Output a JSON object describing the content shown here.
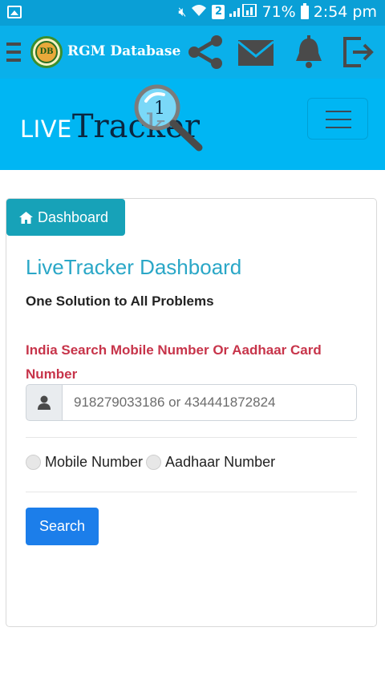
{
  "status_bar": {
    "battery_percent": "71%",
    "time": "2:54 pm",
    "sim_slot": "2",
    "icons": [
      "image-icon",
      "mute-icon",
      "wifi-icon",
      "signal-icon",
      "battery-icon"
    ]
  },
  "app_bar": {
    "title": "RGM Database",
    "logo_text": "DB",
    "icons": [
      "menu-icon",
      "share-icon",
      "mail-icon",
      "bell-icon",
      "exit-icon"
    ],
    "color": "#0ab0ea"
  },
  "banner": {
    "brand_live": "LIVE",
    "brand_tracker": "Tracker",
    "color": "#00b6f3"
  },
  "dashboard": {
    "tab_label": "Dashboard",
    "title": "LiveTracker Dashboard",
    "subtitle": "One Solution to All Problems",
    "search_label": "India Search Mobile Number Or Aadhaar Card Number",
    "search_placeholder": "918279033186 or 434441872824",
    "search_value": "",
    "radio_options": [
      "Mobile Number",
      "Aadhaar Number"
    ],
    "search_button": "Search",
    "accent_color": "#17a2b8",
    "button_color": "#1c7eea",
    "label_color": "#c7344a"
  }
}
